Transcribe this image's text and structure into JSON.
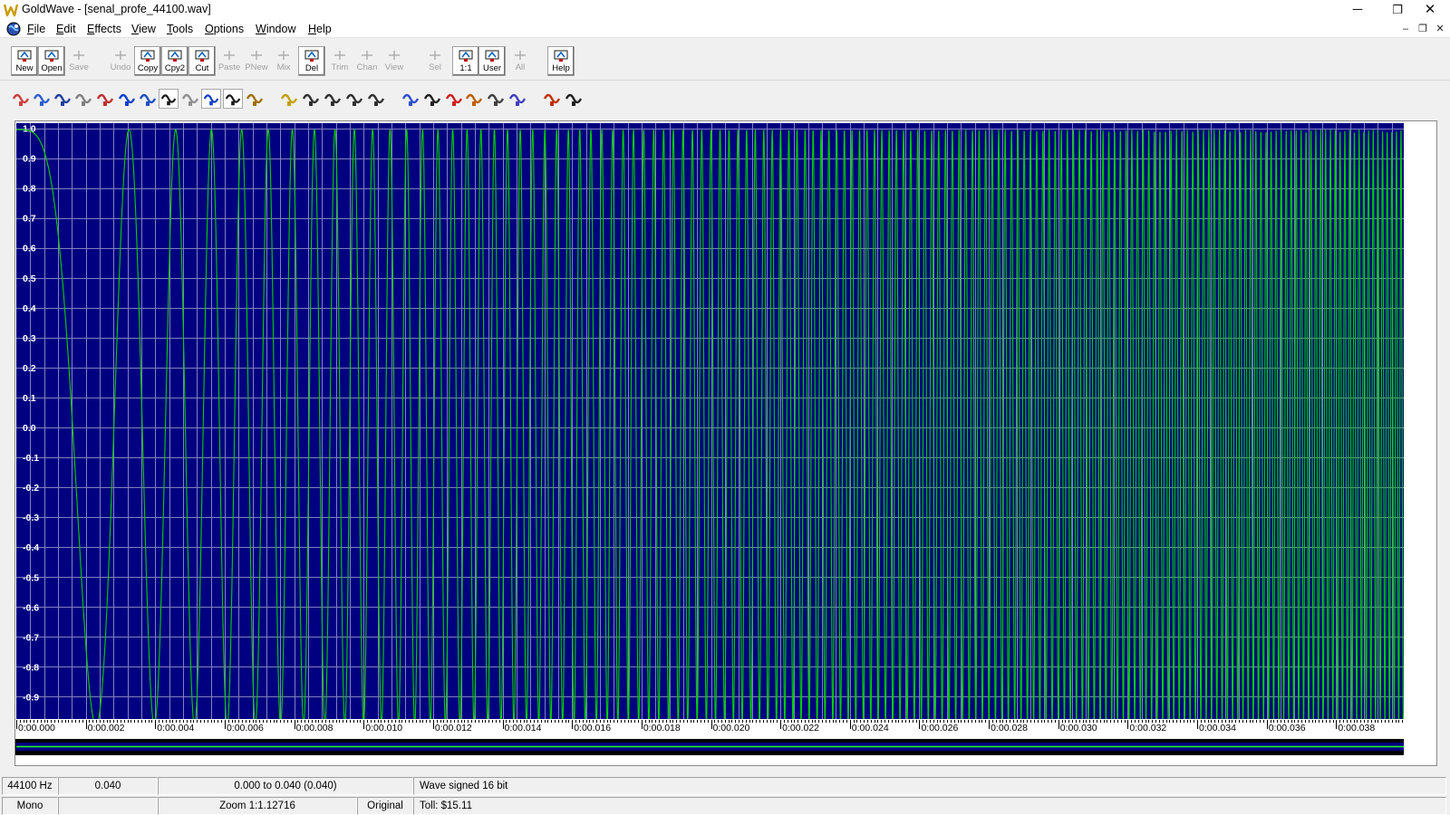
{
  "window": {
    "title": "GoldWave - [senal_profe_44100.wav]",
    "minimize_glyph": "─",
    "maximize_glyph": "❐",
    "close_glyph": "✕",
    "mdi_minimize_glyph": "–",
    "mdi_restore_glyph": "❐",
    "mdi_close_glyph": "✕"
  },
  "menu": [
    "File",
    "Edit",
    "Effects",
    "View",
    "Tools",
    "Options",
    "Window",
    "Help"
  ],
  "toolbar": {
    "buttons": [
      {
        "label": "New",
        "icon": "new-icon",
        "enabled": true
      },
      {
        "label": "Open",
        "icon": "open-icon",
        "enabled": true
      },
      {
        "label": "Save",
        "icon": "save-icon",
        "enabled": false
      },
      {
        "label": "Undo",
        "icon": "undo-icon",
        "enabled": false
      },
      {
        "label": "Copy",
        "icon": "copy-icon",
        "enabled": true
      },
      {
        "label": "Cpy2",
        "icon": "copy2-icon",
        "enabled": true
      },
      {
        "label": "Cut",
        "icon": "scissors-icon",
        "enabled": true
      },
      {
        "label": "Paste",
        "icon": "paste-icon",
        "enabled": false
      },
      {
        "label": "PNew",
        "icon": "paste-new-icon",
        "enabled": false
      },
      {
        "label": "Mix",
        "icon": "mix-icon",
        "enabled": false
      },
      {
        "label": "Del",
        "icon": "delete-icon",
        "enabled": true
      },
      {
        "label": "Trim",
        "icon": "trim-icon",
        "enabled": false
      },
      {
        "label": "Chan",
        "icon": "channel-icon",
        "enabled": false
      },
      {
        "label": "View",
        "icon": "view-icon",
        "enabled": false
      },
      {
        "label": "Sel",
        "icon": "zoom-selection-icon",
        "enabled": false
      },
      {
        "label": "1:1",
        "icon": "zoom-1-1-icon",
        "enabled": true
      },
      {
        "label": "User",
        "icon": "zoom-user-icon",
        "enabled": true
      },
      {
        "label": "All",
        "icon": "zoom-all-icon",
        "enabled": false
      },
      {
        "label": "Help",
        "icon": "help-book-icon",
        "enabled": true
      }
    ]
  },
  "effects_toolbar": {
    "icons": [
      "auto-gain-icon",
      "compressor-icon",
      "doppler-icon",
      "dynamics-icon",
      "echo-icon",
      "equalizer-icon",
      "invert-icon",
      "mechanize-icon",
      "noise-reduction-icon",
      "offset-icon",
      "silence-icon",
      "pan-icon",
      "pitch-icon",
      "playback-rate-icon",
      "resample-icon",
      "reverse-icon",
      "smoother-icon",
      "volume-change-icon",
      "volume-shape-icon",
      "spectrum-filter-icon",
      "parametric-eq-icon",
      "bandpass-icon",
      "channel-mixer-icon",
      "marker-icon",
      "expression-evaluator-icon"
    ]
  },
  "waveform": {
    "y_axis_labels": [
      "1.0",
      "0.9",
      "0.8",
      "0.7",
      "0.6",
      "0.5",
      "0.4",
      "0.3",
      "0.2",
      "0.1",
      "0.0",
      "-0.1",
      "-0.2",
      "-0.3",
      "-0.4",
      "-0.5",
      "-0.6",
      "-0.7",
      "-0.8",
      "-0.9"
    ],
    "time_labels": [
      "0:00.000",
      "0:00.002",
      "0:00.004",
      "0:00.006",
      "0:00.008",
      "0:00.010",
      "0:00.012",
      "0:00.014",
      "0:00.016",
      "0:00.018",
      "0:00.020",
      "0:00.022",
      "0:00.024",
      "0:00.026",
      "0:00.028",
      "0:00.030",
      "0:00.032",
      "0:00.034",
      "0:00.036",
      "0:00.038"
    ],
    "colors": {
      "background": "#000080",
      "grid": "#8080c0",
      "wave": "#00d000",
      "wave_bright": "#20ff20"
    }
  },
  "status": {
    "sample_rate": "44100 Hz",
    "duration": "0.040",
    "selection": "0.000 to 0.040 (0.040)",
    "format": "Wave signed 16 bit",
    "channels": "Mono",
    "blank1": "",
    "zoom": "Zoom 1:1.12716",
    "blank2": "",
    "original": "Original",
    "toll": "Toll: $15.11"
  }
}
